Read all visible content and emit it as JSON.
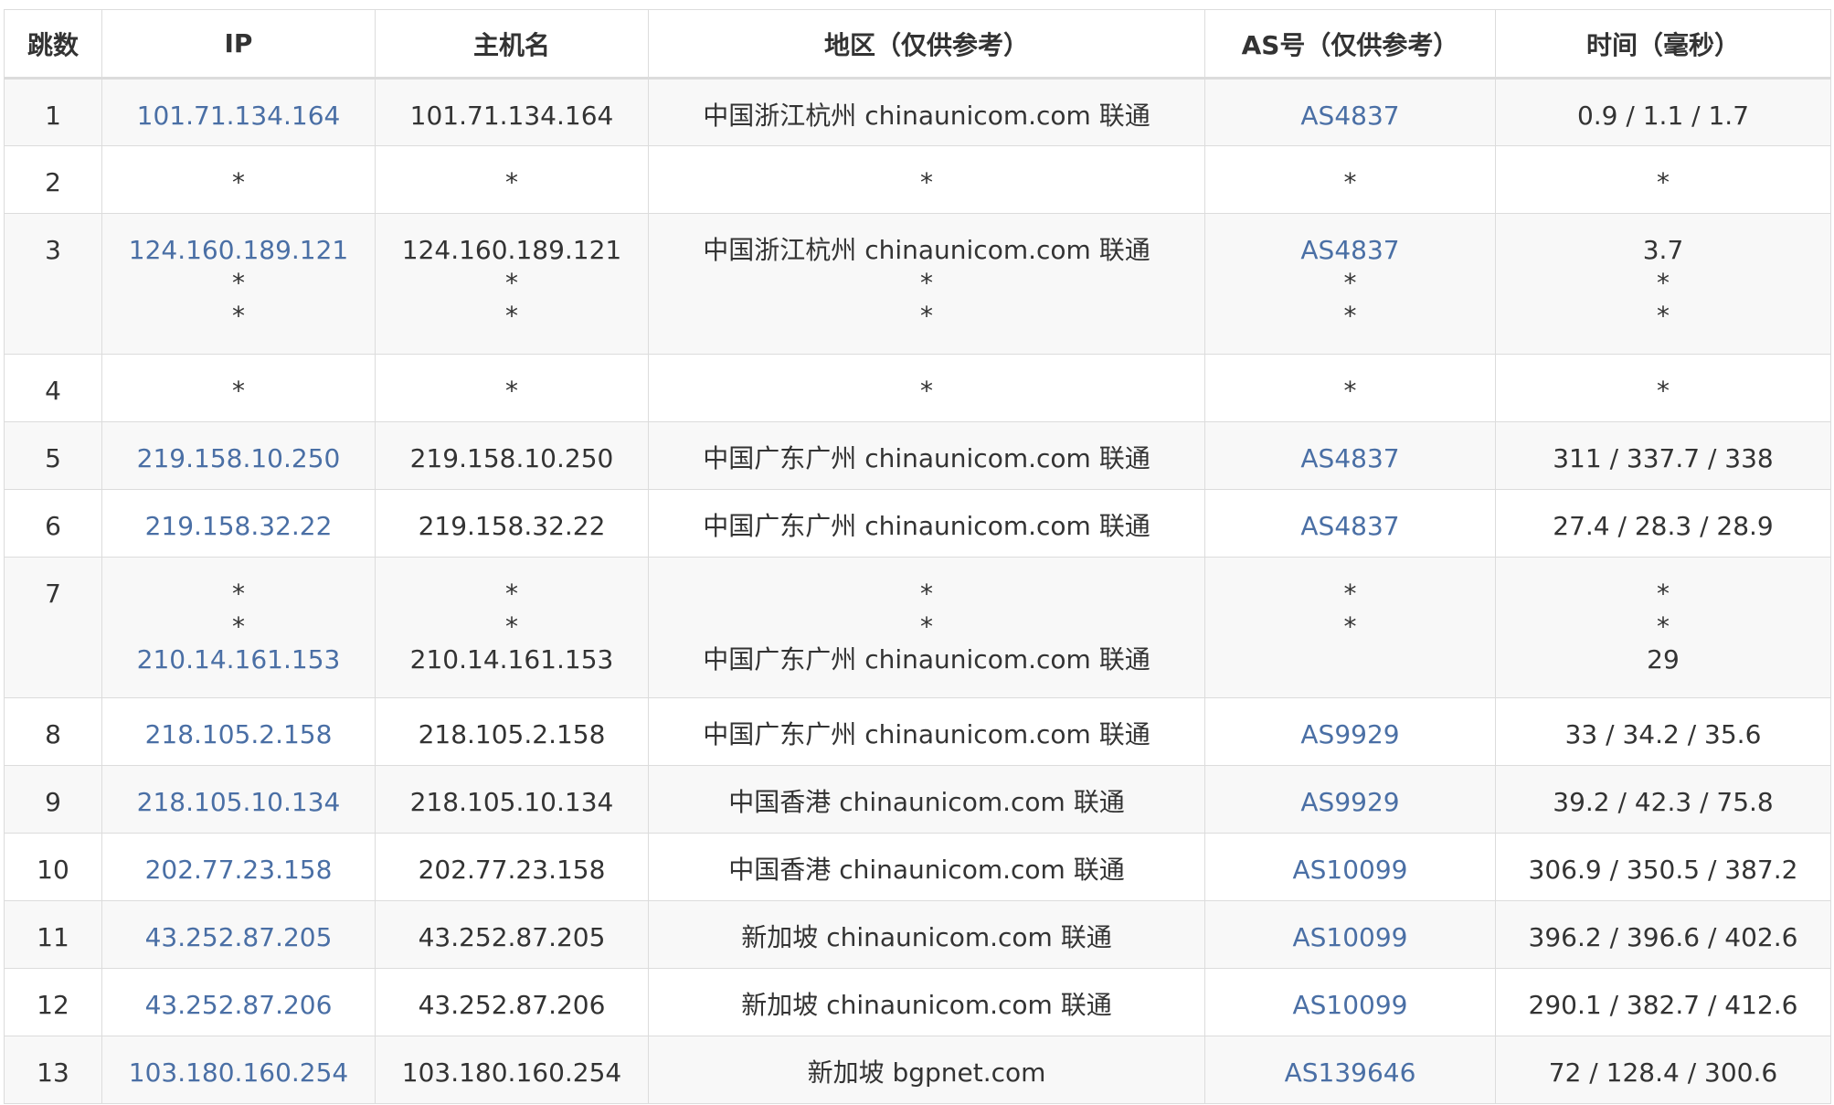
{
  "headers": [
    "跳数",
    "IP",
    "主机名",
    "地区（仅供参考）",
    "AS号（仅供参考）",
    "时间（毫秒）"
  ],
  "rows": [
    {
      "hop": "1",
      "ip": [
        "101.71.134.164"
      ],
      "host": [
        "101.71.134.164"
      ],
      "region": [
        "中国浙江杭州 chinaunicom.com 联通"
      ],
      "asn": [
        "AS4837"
      ],
      "time": [
        "0.9 / 1.1 / 1.7"
      ]
    },
    {
      "hop": "2",
      "ip": [
        "*"
      ],
      "host": [
        "*"
      ],
      "region": [
        "*"
      ],
      "asn": [
        "*"
      ],
      "time": [
        "*"
      ]
    },
    {
      "hop": "3",
      "ip": [
        "124.160.189.121",
        "*",
        "*"
      ],
      "host": [
        "124.160.189.121",
        "*",
        "*"
      ],
      "region": [
        "中国浙江杭州 chinaunicom.com 联通",
        "*",
        "*"
      ],
      "asn": [
        "AS4837",
        "*",
        "*"
      ],
      "time": [
        "3.7",
        "*",
        "*"
      ]
    },
    {
      "hop": "4",
      "ip": [
        "*"
      ],
      "host": [
        "*"
      ],
      "region": [
        "*"
      ],
      "asn": [
        "*"
      ],
      "time": [
        "*"
      ]
    },
    {
      "hop": "5",
      "ip": [
        "219.158.10.250"
      ],
      "host": [
        "219.158.10.250"
      ],
      "region": [
        "中国广东广州 chinaunicom.com 联通"
      ],
      "asn": [
        "AS4837"
      ],
      "time": [
        "311 / 337.7 / 338"
      ]
    },
    {
      "hop": "6",
      "ip": [
        "219.158.32.22"
      ],
      "host": [
        "219.158.32.22"
      ],
      "region": [
        "中国广东广州 chinaunicom.com 联通"
      ],
      "asn": [
        "AS4837"
      ],
      "time": [
        "27.4 / 28.3 / 28.9"
      ]
    },
    {
      "hop": "7",
      "ip": [
        "*",
        "*",
        "210.14.161.153"
      ],
      "host": [
        "*",
        "*",
        "210.14.161.153"
      ],
      "region": [
        "*",
        "*",
        "中国广东广州 chinaunicom.com 联通"
      ],
      "asn": [
        "*",
        "*",
        ""
      ],
      "time": [
        "*",
        "*",
        "29"
      ]
    },
    {
      "hop": "8",
      "ip": [
        "218.105.2.158"
      ],
      "host": [
        "218.105.2.158"
      ],
      "region": [
        "中国广东广州 chinaunicom.com 联通"
      ],
      "asn": [
        "AS9929"
      ],
      "time": [
        "33 / 34.2 / 35.6"
      ]
    },
    {
      "hop": "9",
      "ip": [
        "218.105.10.134"
      ],
      "host": [
        "218.105.10.134"
      ],
      "region": [
        "中国香港 chinaunicom.com 联通"
      ],
      "asn": [
        "AS9929"
      ],
      "time": [
        "39.2 / 42.3 / 75.8"
      ]
    },
    {
      "hop": "10",
      "ip": [
        "202.77.23.158"
      ],
      "host": [
        "202.77.23.158"
      ],
      "region": [
        "中国香港 chinaunicom.com 联通"
      ],
      "asn": [
        "AS10099"
      ],
      "time": [
        "306.9 / 350.5 / 387.2"
      ]
    },
    {
      "hop": "11",
      "ip": [
        "43.252.87.205"
      ],
      "host": [
        "43.252.87.205"
      ],
      "region": [
        "新加坡 chinaunicom.com 联通"
      ],
      "asn": [
        "AS10099"
      ],
      "time": [
        "396.2 / 396.6 / 402.6"
      ]
    },
    {
      "hop": "12",
      "ip": [
        "43.252.87.206"
      ],
      "host": [
        "43.252.87.206"
      ],
      "region": [
        "新加坡 chinaunicom.com 联通"
      ],
      "asn": [
        "AS10099"
      ],
      "time": [
        "290.1 / 382.7 / 412.6"
      ]
    },
    {
      "hop": "13",
      "ip": [
        "103.180.160.254"
      ],
      "host": [
        "103.180.160.254"
      ],
      "region": [
        "新加坡 bgpnet.com"
      ],
      "asn": [
        "AS139646"
      ],
      "time": [
        "72 / 128.4 / 300.6"
      ]
    }
  ],
  "colors": {
    "link": "#4a6fa5",
    "text": "#333333",
    "border": "#dcdcdc",
    "stripe": "#f8f8f8"
  }
}
